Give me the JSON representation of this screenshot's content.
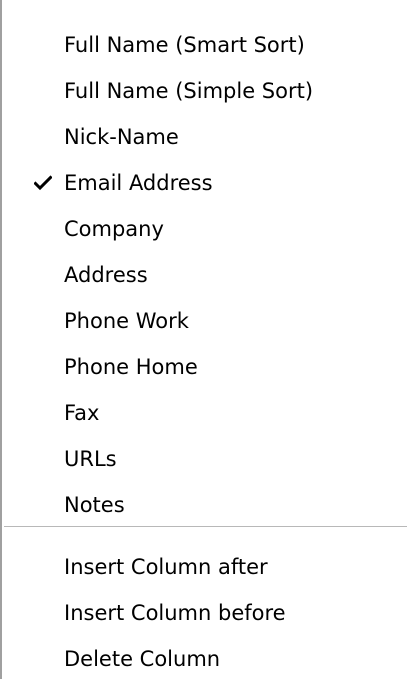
{
  "menu": {
    "column_items": [
      {
        "label": "Full Name (Smart Sort)",
        "checked": false
      },
      {
        "label": "Full Name (Simple Sort)",
        "checked": false
      },
      {
        "label": "Nick-Name",
        "checked": false
      },
      {
        "label": "Email Address",
        "checked": true
      },
      {
        "label": "Company",
        "checked": false
      },
      {
        "label": "Address",
        "checked": false
      },
      {
        "label": "Phone Work",
        "checked": false
      },
      {
        "label": "Phone Home",
        "checked": false
      },
      {
        "label": "Fax",
        "checked": false
      },
      {
        "label": "URLs",
        "checked": false
      },
      {
        "label": "Notes",
        "checked": false
      }
    ],
    "action_items": [
      {
        "label": "Insert Column after"
      },
      {
        "label": "Insert Column before"
      },
      {
        "label": "Delete Column"
      }
    ]
  },
  "colors": {
    "background": "#ffffff",
    "text": "#000000",
    "separator": "#b8b8b8",
    "left_border": "#a0a0a0"
  },
  "icons": {
    "checked_indicator": "checkmark-icon"
  }
}
